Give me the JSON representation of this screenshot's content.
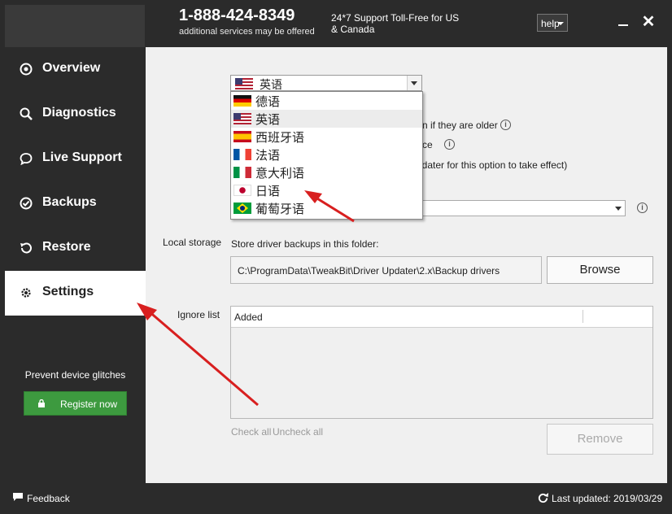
{
  "header": {
    "phone": "1-888-424-8349",
    "phone_note": "additional services may be offered",
    "support_text": "24*7 Support Toll-Free for US & Canada",
    "help_label": "help",
    "minimize_icon": "minimize-icon",
    "close_icon": "close-icon"
  },
  "sidebar": {
    "items": [
      {
        "label": "Overview",
        "icon": "overview-icon"
      },
      {
        "label": "Diagnostics",
        "icon": "search-icon"
      },
      {
        "label": "Live Support",
        "icon": "chat-icon"
      },
      {
        "label": "Backups",
        "icon": "backup-icon"
      },
      {
        "label": "Restore",
        "icon": "restore-icon"
      },
      {
        "label": "Settings",
        "icon": "gear-icon"
      }
    ],
    "active": "Settings",
    "promo_text": "Prevent device glitches",
    "register_label": "Register now"
  },
  "settings": {
    "language_value": "英语",
    "option1_text": "n if they are older",
    "option2_text": "ce",
    "option3_text": "pdater for this option to take effect)",
    "local_storage_label": "Local storage",
    "folder_caption": "Store driver backups in this folder:",
    "backup_path": "C:\\ProgramData\\TweakBit\\Driver Updater\\2.x\\Backup drivers",
    "browse_label": "Browse",
    "ignore_list_label": "Ignore list",
    "ignore_column": "Added",
    "check_all": "Check all",
    "uncheck_all": "Uncheck all",
    "remove_label": "Remove"
  },
  "language_options": [
    {
      "label": "德语",
      "flag": "flag-de"
    },
    {
      "label": "英语",
      "flag": "flag-us"
    },
    {
      "label": "西班牙语",
      "flag": "flag-es"
    },
    {
      "label": "法语",
      "flag": "flag-fr"
    },
    {
      "label": "意大利语",
      "flag": "flag-it"
    },
    {
      "label": "日语",
      "flag": "flag-jp"
    },
    {
      "label": "葡萄牙语",
      "flag": "flag-br"
    }
  ],
  "highlighted_language": "英语",
  "footer": {
    "feedback_label": "Feedback",
    "last_updated": "Last updated: 2019/03/29"
  },
  "colors": {
    "dark_bg": "#2b2b2b",
    "content_bg": "#f0f0f0",
    "register_green": "#3d9a3f",
    "annotation_red": "#d81f1f"
  }
}
